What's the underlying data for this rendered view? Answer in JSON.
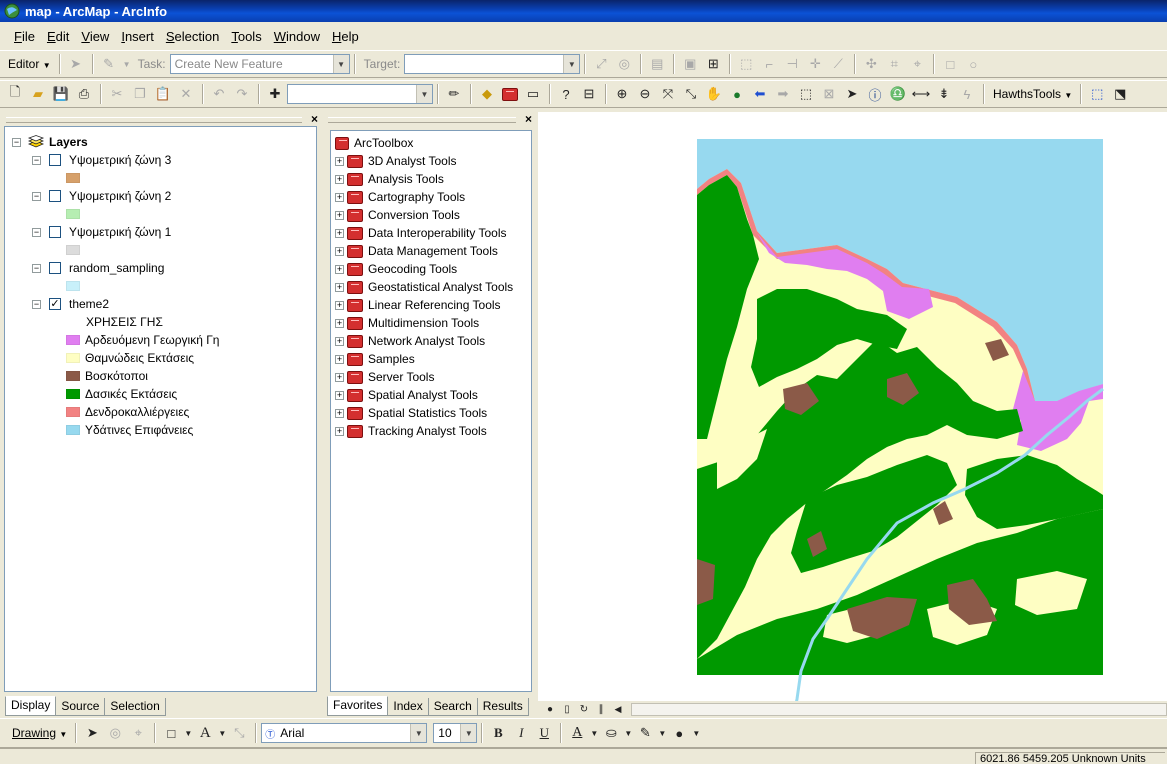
{
  "window": {
    "title": "map - ArcMap - ArcInfo"
  },
  "menu": [
    "File",
    "Edit",
    "View",
    "Insert",
    "Selection",
    "Tools",
    "Window",
    "Help"
  ],
  "editor_toolbar": {
    "editor_label": "Editor",
    "task_label": "Task:",
    "task_value": "Create New Feature",
    "target_label": "Target:",
    "target_value": ""
  },
  "standard_toolbar": {
    "scale_value": "",
    "hawths_label": "HawthsTools"
  },
  "toc": {
    "root": "Layers",
    "layers": [
      {
        "name": "Υψομετρική ζώνη 3",
        "checked": false,
        "swatch": "#d6a06a"
      },
      {
        "name": "Υψομετρική ζώνη 2",
        "checked": false,
        "swatch": "#b6eeb2"
      },
      {
        "name": "Υψομετρική ζώνη 1",
        "checked": false,
        "swatch": "#dcdcdc"
      },
      {
        "name": "random_sampling",
        "checked": false,
        "swatch": "#c8f0fa"
      },
      {
        "name": "theme2",
        "checked": true,
        "swatch": ""
      }
    ],
    "legend_heading": "ΧΡΗΣΕΙΣ ΓΗΣ",
    "legend": [
      {
        "label": "Αρδευόμενη Γεωργική Γη",
        "color": "#e07ef0"
      },
      {
        "label": "Θαμνώδεις Εκτάσεις",
        "color": "#fefec3"
      },
      {
        "label": "Βοσκότοποι",
        "color": "#8b5a48"
      },
      {
        "label": "Δασικές Εκτάσεις",
        "color": "#009900"
      },
      {
        "label": "Δενδροκαλλιέργειες",
        "color": "#f28282"
      },
      {
        "label": "Υδάτινες Επιφάνειες",
        "color": "#97d9ef"
      }
    ],
    "tabs": [
      "Display",
      "Source",
      "Selection"
    ],
    "check_mark": "✓"
  },
  "arctoolbox": {
    "root": "ArcToolbox",
    "items": [
      "3D Analyst Tools",
      "Analysis Tools",
      "Cartography Tools",
      "Conversion Tools",
      "Data Interoperability Tools",
      "Data Management Tools",
      "Geocoding Tools",
      "Geostatistical Analyst Tools",
      "Linear Referencing Tools",
      "Multidimension Tools",
      "Network Analyst Tools",
      "Samples",
      "Server Tools",
      "Spatial Analyst Tools",
      "Spatial Statistics Tools",
      "Tracking Analyst Tools"
    ],
    "tabs": [
      "Favorites",
      "Index",
      "Search",
      "Results"
    ]
  },
  "drawing_toolbar": {
    "drawing_label": "Drawing",
    "font_value": "Arial",
    "size_value": "10",
    "bold": "B",
    "italic": "I",
    "underline": "U",
    "text_tool": "A"
  },
  "status": {
    "coordinates": "6021.86 5459.205 Unknown Units"
  },
  "map_colors": {
    "water": "#97d9ef",
    "shrub": "#fefec3",
    "forest": "#009900",
    "pasture": "#8b5a48",
    "irrigated": "#e07ef0",
    "orchards": "#f28282"
  }
}
